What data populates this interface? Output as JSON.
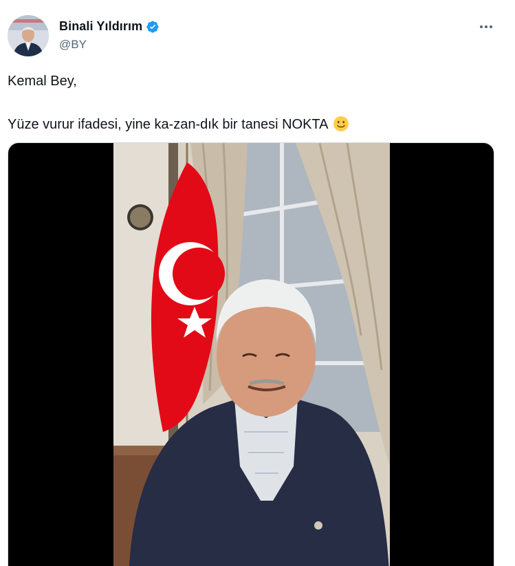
{
  "author": {
    "display_name": "Binali Yıldırım",
    "handle": "@BY",
    "verified": true,
    "avatar_icon": "profile-photo"
  },
  "menu": {
    "more_icon": "more-options-icon"
  },
  "tweet": {
    "line1": "Kemal Bey,",
    "line2": "Yüze vurur ifadesi, yine ka-zan-dık bir tanesi NOKTA",
    "emoji": "slightly-smiling-face-icon"
  },
  "media": {
    "type": "video",
    "content": "video-thumbnail"
  },
  "colors": {
    "text": "#0f1419",
    "secondary_text": "#536471",
    "verified_blue": "#1d9bf0",
    "media_background": "#000000",
    "flag_red": "#e30a17"
  }
}
